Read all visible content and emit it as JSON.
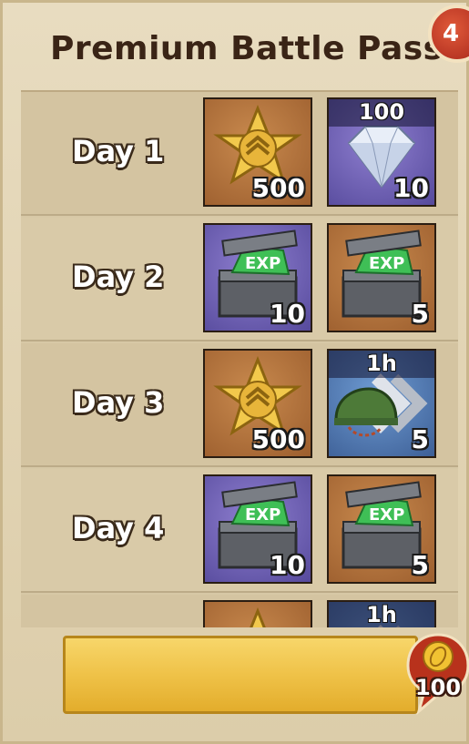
{
  "header": {
    "title": "Premium Battle Pass",
    "corner_badge": "4"
  },
  "rows": [
    {
      "day": "Day 1",
      "item1": {
        "icon": "star-badge-icon",
        "bg": "brown",
        "qty": "500"
      },
      "item2": {
        "icon": "diamond-icon",
        "bg": "purple",
        "qty": "10",
        "top_label": "100"
      }
    },
    {
      "day": "Day 2",
      "item1": {
        "icon": "exp-chest-icon",
        "bg": "purple",
        "qty": "10"
      },
      "item2": {
        "icon": "exp-chest-icon",
        "bg": "brown",
        "qty": "5"
      }
    },
    {
      "day": "Day 3",
      "item1": {
        "icon": "star-badge-icon",
        "bg": "brown",
        "qty": "500"
      },
      "item2": {
        "icon": "helmet-speedup-icon",
        "bg": "blue",
        "qty": "5",
        "top_label": "1h"
      }
    },
    {
      "day": "Day 4",
      "item1": {
        "icon": "exp-chest-icon",
        "bg": "purple",
        "qty": "10"
      },
      "item2": {
        "icon": "exp-chest-icon",
        "bg": "brown",
        "qty": "5"
      }
    },
    {
      "day": "",
      "item1": {
        "icon": "star-badge-icon",
        "bg": "brown",
        "qty": ""
      },
      "item2": {
        "icon": "helmet-speedup-icon",
        "bg": "blue",
        "qty": "",
        "top_label": "1h"
      }
    }
  ],
  "buy_button": {
    "label": ""
  },
  "price": {
    "icon": "coin-icon",
    "value": "100"
  },
  "colors": {
    "accent": "#efc248",
    "badge_red": "#c2331f",
    "text_dark": "#3a2416"
  }
}
